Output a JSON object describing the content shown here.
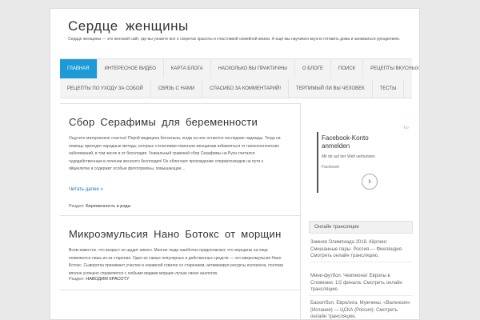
{
  "site": {
    "title": "Сердце женщины",
    "description": "Сердце женщины — это женский сайт, где вы узнаете все о секретах красоты и счастливой семейной жизни. А ещё мы научимся вкусно готовить дома и заниматься рукоделием."
  },
  "nav": {
    "row1": [
      "Главная",
      "Интересное видео",
      "Карта блога",
      "Насколько вы практичны",
      "О блоге",
      "Поиск",
      "Рецепты вкусных блюд"
    ],
    "row2": [
      "Рецепты по уходу за собой",
      "Связь с нами",
      "Спасибо за комментарий!",
      "Терпимый ли вы человек",
      "Тесты"
    ]
  },
  "posts": [
    {
      "title": "Сбор Серафимы для беременности",
      "excerpt": "Ощутите материнское счастье! Порой медицина бессильна, когда на нее остаются последние надежды. Тогда на помощь приходят народные методы, которые столетиями помогали женщинам избавляться от гинекологических заболеваний, в том числе и от бесплодия. Уникальный травяной сбор Серафимы на Руси считался чудодейственным в лечении женского бесплодия! Он облегчает прохождение сперматозоидов на пути к яйцеклетке и содержит особые фитогормоны, повышающие…",
      "read_more": "Читать далее »",
      "category_label": "Раздел:",
      "category": "Беременность и роды"
    },
    {
      "title": "Микроэмульсия Нано Ботокс от морщин",
      "excerpt": "Всем известно, что возраст не щадит никого. Многие люди ошибочно предполагают, что морщины на лице появляются лишь из-за старения. Одно из самых популярных и действенных средств — это микроэмульсия Нано Ботокс. Сыворотка принимает участие в неравной схватке со старением, активизируя ресурсы коллагена, поэтому вполне успешно справляется с любыми видами морщин лучше своих аналогов.",
      "category_label": "Раздел:",
      "category": "НАВОДИМ КРАСОТУ"
    }
  ],
  "ad": {
    "title": "Facebook-Konto anmelden",
    "subtitle": "Mit dir auf der Welt verbunden",
    "brand": "Facebook",
    "arrow_icon": "chevron-right-icon",
    "badge": "i ▷"
  },
  "sidebar": {
    "widget_title": "Онлайн трансляции",
    "items": [
      "Зимняя Олимпиада 2018. Кёрлинг. Смешанные пары. Россия — Финляндия. Смотреть онлайн трансляцию.",
      "Мини-футбол. Чемпионат Европы в Словении. 1/2 финала. Смотреть онлайн трансляцию.",
      "Баскетбол. Евролига. Мужчины. «Валенсия» (Испания) — ЦСКА (Россия). Смотреть онлайн трансляцию."
    ]
  },
  "colors": {
    "accent": "#1e9ad7",
    "link": "#1e73be",
    "background": "#e9e9e9"
  }
}
